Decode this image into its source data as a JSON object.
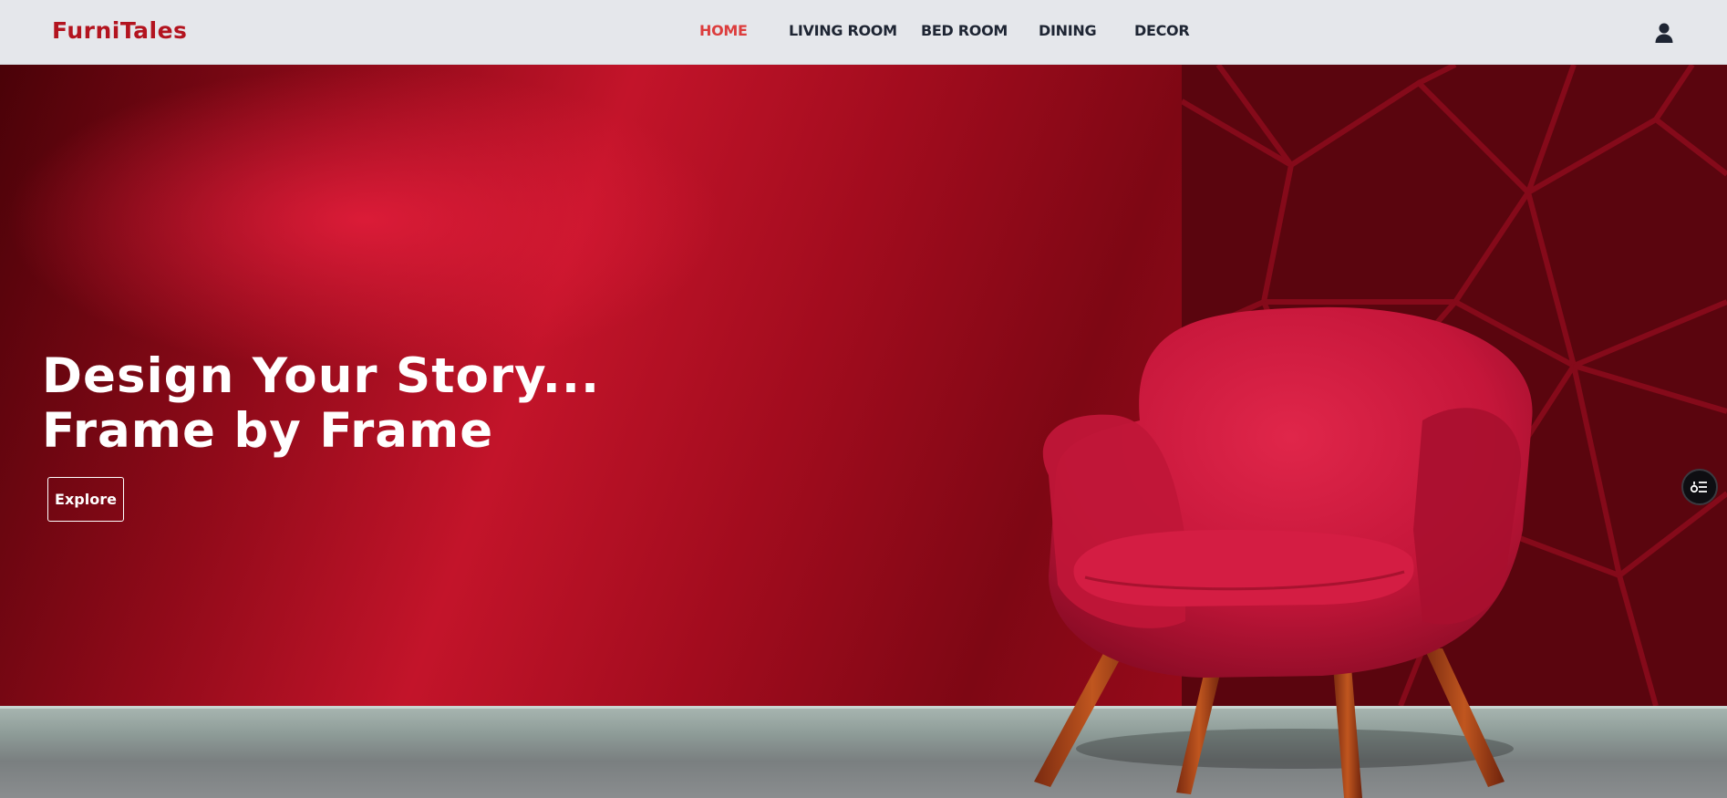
{
  "brand": {
    "name": "FurniTales"
  },
  "nav": {
    "items": [
      {
        "label": "HOME",
        "active": true
      },
      {
        "label": "LIVING ROOM",
        "active": false
      },
      {
        "label": "BED ROOM",
        "active": false
      },
      {
        "label": "DINING",
        "active": false
      },
      {
        "label": "DECOR",
        "active": false
      }
    ],
    "user_icon": "user-icon"
  },
  "hero": {
    "title_line1": "Design Your Story...",
    "title_line2": "Frame by Frame",
    "cta_label": "Explore",
    "image": "red-armchair-photo",
    "side_widget_icon": "filter-list-icon"
  },
  "colors": {
    "brand": "#b3141f",
    "nav_active": "#dc3d3d",
    "nav_text": "#1e2533",
    "navbar_bg": "#e5e7eb",
    "hero_red": "#c3142a"
  }
}
